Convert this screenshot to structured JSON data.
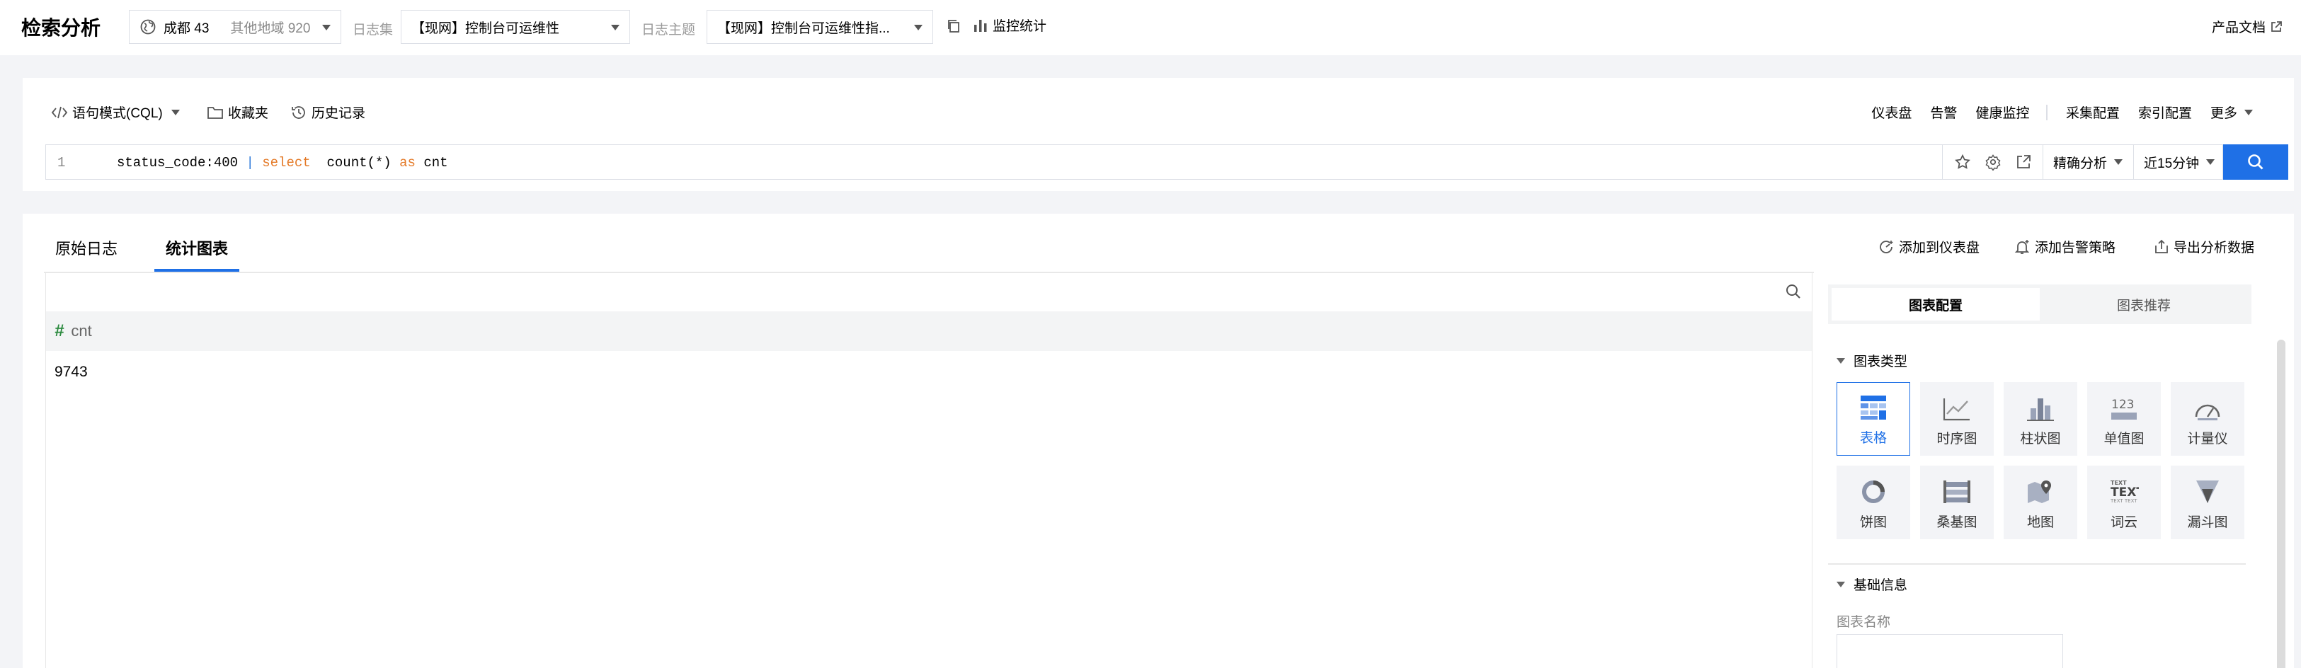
{
  "topbar": {
    "title": "检索分析",
    "region_current": "成都 43",
    "region_other": "其他地域 920",
    "logset_label": "日志集",
    "logset_value": "【现网】控制台可运维性",
    "topic_label": "日志主题",
    "topic_value": "【现网】控制台可运维性指...",
    "monitor_label": "监控统计",
    "docs_label": "产品文档"
  },
  "query": {
    "mode_label": "语句模式(CQL)",
    "favorites_label": "收藏夹",
    "history_label": "历史记录",
    "links": [
      "仪表盘",
      "告警",
      "健康监控",
      "采集配置",
      "索引配置",
      "更多"
    ],
    "line_number": "1",
    "code_filter": "status_code:400",
    "code_pipe": "|",
    "code_select": "select",
    "code_func": "count(*)",
    "code_as": "as",
    "code_alias": "cnt",
    "analysis_mode": "精确分析",
    "time_range": "近15分钟"
  },
  "result": {
    "tabs": [
      "原始日志",
      "统计图表"
    ],
    "actions": [
      "添加到仪表盘",
      "添加告警策略",
      "导出分析数据"
    ],
    "column_header_hash": "#",
    "column_header": "cnt",
    "cell_value": "9743"
  },
  "panel": {
    "segments": [
      "图表配置",
      "图表推荐"
    ],
    "chart_type_title": "图表类型",
    "chart_types": [
      "表格",
      "时序图",
      "柱状图",
      "单值图",
      "计量仪",
      "饼图",
      "桑基图",
      "地图",
      "词云",
      "漏斗图"
    ],
    "basic_info_title": "基础信息",
    "chart_name_label": "图表名称"
  },
  "colors": {
    "accent": "#1f70e6",
    "keyword": "#e47a28",
    "hash": "#2b8a3e"
  }
}
